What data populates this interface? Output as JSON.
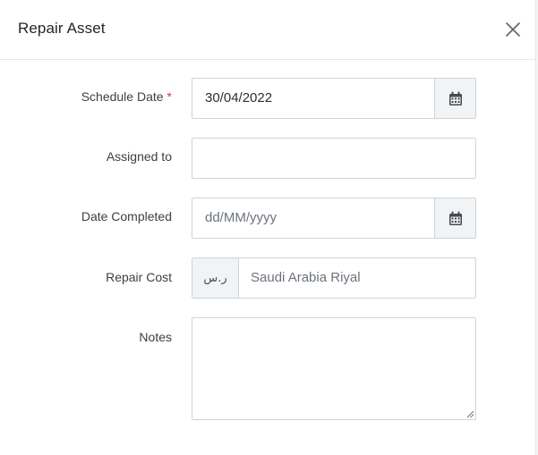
{
  "modal": {
    "title": "Repair Asset"
  },
  "form": {
    "schedule_date": {
      "label": "Schedule Date",
      "required_mark": "*",
      "value": "30/04/2022"
    },
    "assigned_to": {
      "label": "Assigned to",
      "value": ""
    },
    "date_completed": {
      "label": "Date Completed",
      "placeholder": "dd/MM/yyyy"
    },
    "repair_cost": {
      "label": "Repair Cost",
      "currency_symbol": "ر.س",
      "placeholder": "Saudi Arabia Riyal"
    },
    "notes": {
      "label": "Notes",
      "value": ""
    }
  },
  "icons": {
    "close": "close-icon",
    "calendar": "calendar-icon"
  },
  "colors": {
    "required": "#dc3545",
    "border": "#ced4da",
    "addon_bg": "#f1f3f5"
  }
}
